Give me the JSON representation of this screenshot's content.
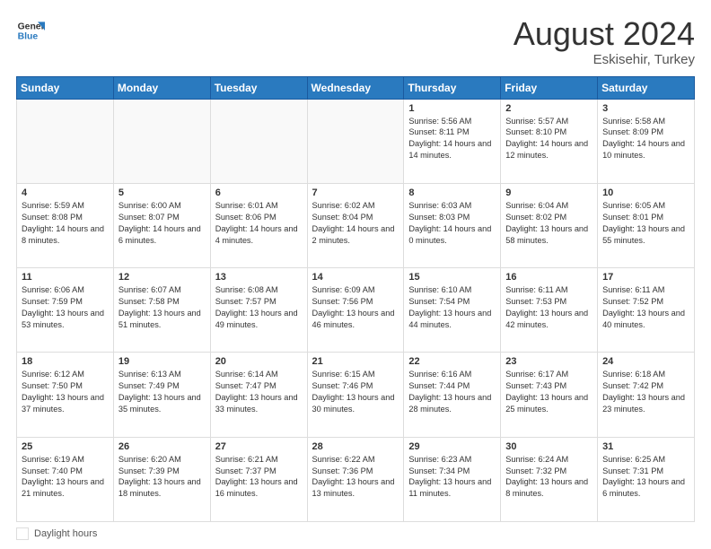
{
  "header": {
    "logo_line1": "General",
    "logo_line2": "Blue",
    "month": "August 2024",
    "location": "Eskisehir, Turkey"
  },
  "weekdays": [
    "Sunday",
    "Monday",
    "Tuesday",
    "Wednesday",
    "Thursday",
    "Friday",
    "Saturday"
  ],
  "weeks": [
    [
      {
        "day": "",
        "sunrise": "",
        "sunset": "",
        "daylight": ""
      },
      {
        "day": "",
        "sunrise": "",
        "sunset": "",
        "daylight": ""
      },
      {
        "day": "",
        "sunrise": "",
        "sunset": "",
        "daylight": ""
      },
      {
        "day": "",
        "sunrise": "",
        "sunset": "",
        "daylight": ""
      },
      {
        "day": "1",
        "sunrise": "Sunrise: 5:56 AM",
        "sunset": "Sunset: 8:11 PM",
        "daylight": "Daylight: 14 hours and 14 minutes."
      },
      {
        "day": "2",
        "sunrise": "Sunrise: 5:57 AM",
        "sunset": "Sunset: 8:10 PM",
        "daylight": "Daylight: 14 hours and 12 minutes."
      },
      {
        "day": "3",
        "sunrise": "Sunrise: 5:58 AM",
        "sunset": "Sunset: 8:09 PM",
        "daylight": "Daylight: 14 hours and 10 minutes."
      }
    ],
    [
      {
        "day": "4",
        "sunrise": "Sunrise: 5:59 AM",
        "sunset": "Sunset: 8:08 PM",
        "daylight": "Daylight: 14 hours and 8 minutes."
      },
      {
        "day": "5",
        "sunrise": "Sunrise: 6:00 AM",
        "sunset": "Sunset: 8:07 PM",
        "daylight": "Daylight: 14 hours and 6 minutes."
      },
      {
        "day": "6",
        "sunrise": "Sunrise: 6:01 AM",
        "sunset": "Sunset: 8:06 PM",
        "daylight": "Daylight: 14 hours and 4 minutes."
      },
      {
        "day": "7",
        "sunrise": "Sunrise: 6:02 AM",
        "sunset": "Sunset: 8:04 PM",
        "daylight": "Daylight: 14 hours and 2 minutes."
      },
      {
        "day": "8",
        "sunrise": "Sunrise: 6:03 AM",
        "sunset": "Sunset: 8:03 PM",
        "daylight": "Daylight: 14 hours and 0 minutes."
      },
      {
        "day": "9",
        "sunrise": "Sunrise: 6:04 AM",
        "sunset": "Sunset: 8:02 PM",
        "daylight": "Daylight: 13 hours and 58 minutes."
      },
      {
        "day": "10",
        "sunrise": "Sunrise: 6:05 AM",
        "sunset": "Sunset: 8:01 PM",
        "daylight": "Daylight: 13 hours and 55 minutes."
      }
    ],
    [
      {
        "day": "11",
        "sunrise": "Sunrise: 6:06 AM",
        "sunset": "Sunset: 7:59 PM",
        "daylight": "Daylight: 13 hours and 53 minutes."
      },
      {
        "day": "12",
        "sunrise": "Sunrise: 6:07 AM",
        "sunset": "Sunset: 7:58 PM",
        "daylight": "Daylight: 13 hours and 51 minutes."
      },
      {
        "day": "13",
        "sunrise": "Sunrise: 6:08 AM",
        "sunset": "Sunset: 7:57 PM",
        "daylight": "Daylight: 13 hours and 49 minutes."
      },
      {
        "day": "14",
        "sunrise": "Sunrise: 6:09 AM",
        "sunset": "Sunset: 7:56 PM",
        "daylight": "Daylight: 13 hours and 46 minutes."
      },
      {
        "day": "15",
        "sunrise": "Sunrise: 6:10 AM",
        "sunset": "Sunset: 7:54 PM",
        "daylight": "Daylight: 13 hours and 44 minutes."
      },
      {
        "day": "16",
        "sunrise": "Sunrise: 6:11 AM",
        "sunset": "Sunset: 7:53 PM",
        "daylight": "Daylight: 13 hours and 42 minutes."
      },
      {
        "day": "17",
        "sunrise": "Sunrise: 6:11 AM",
        "sunset": "Sunset: 7:52 PM",
        "daylight": "Daylight: 13 hours and 40 minutes."
      }
    ],
    [
      {
        "day": "18",
        "sunrise": "Sunrise: 6:12 AM",
        "sunset": "Sunset: 7:50 PM",
        "daylight": "Daylight: 13 hours and 37 minutes."
      },
      {
        "day": "19",
        "sunrise": "Sunrise: 6:13 AM",
        "sunset": "Sunset: 7:49 PM",
        "daylight": "Daylight: 13 hours and 35 minutes."
      },
      {
        "day": "20",
        "sunrise": "Sunrise: 6:14 AM",
        "sunset": "Sunset: 7:47 PM",
        "daylight": "Daylight: 13 hours and 33 minutes."
      },
      {
        "day": "21",
        "sunrise": "Sunrise: 6:15 AM",
        "sunset": "Sunset: 7:46 PM",
        "daylight": "Daylight: 13 hours and 30 minutes."
      },
      {
        "day": "22",
        "sunrise": "Sunrise: 6:16 AM",
        "sunset": "Sunset: 7:44 PM",
        "daylight": "Daylight: 13 hours and 28 minutes."
      },
      {
        "day": "23",
        "sunrise": "Sunrise: 6:17 AM",
        "sunset": "Sunset: 7:43 PM",
        "daylight": "Daylight: 13 hours and 25 minutes."
      },
      {
        "day": "24",
        "sunrise": "Sunrise: 6:18 AM",
        "sunset": "Sunset: 7:42 PM",
        "daylight": "Daylight: 13 hours and 23 minutes."
      }
    ],
    [
      {
        "day": "25",
        "sunrise": "Sunrise: 6:19 AM",
        "sunset": "Sunset: 7:40 PM",
        "daylight": "Daylight: 13 hours and 21 minutes."
      },
      {
        "day": "26",
        "sunrise": "Sunrise: 6:20 AM",
        "sunset": "Sunset: 7:39 PM",
        "daylight": "Daylight: 13 hours and 18 minutes."
      },
      {
        "day": "27",
        "sunrise": "Sunrise: 6:21 AM",
        "sunset": "Sunset: 7:37 PM",
        "daylight": "Daylight: 13 hours and 16 minutes."
      },
      {
        "day": "28",
        "sunrise": "Sunrise: 6:22 AM",
        "sunset": "Sunset: 7:36 PM",
        "daylight": "Daylight: 13 hours and 13 minutes."
      },
      {
        "day": "29",
        "sunrise": "Sunrise: 6:23 AM",
        "sunset": "Sunset: 7:34 PM",
        "daylight": "Daylight: 13 hours and 11 minutes."
      },
      {
        "day": "30",
        "sunrise": "Sunrise: 6:24 AM",
        "sunset": "Sunset: 7:32 PM",
        "daylight": "Daylight: 13 hours and 8 minutes."
      },
      {
        "day": "31",
        "sunrise": "Sunrise: 6:25 AM",
        "sunset": "Sunset: 7:31 PM",
        "daylight": "Daylight: 13 hours and 6 minutes."
      }
    ]
  ],
  "footer": {
    "daylight_label": "Daylight hours"
  }
}
